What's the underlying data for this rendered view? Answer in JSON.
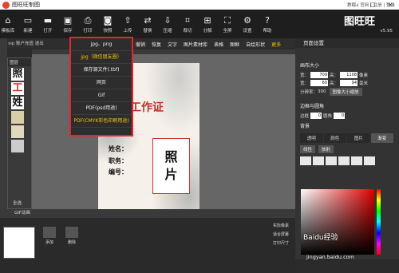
{
  "window": {
    "title": "图旺旺制图",
    "controls": [
      "—",
      "☐",
      "✕"
    ]
  },
  "toolbar": {
    "items": [
      {
        "label": "模板库",
        "icon": "home-icon"
      },
      {
        "label": "新建",
        "icon": "new-file-icon"
      },
      {
        "label": "打开",
        "icon": "folder-icon"
      },
      {
        "label": "保存",
        "icon": "save-icon"
      },
      {
        "label": "打印",
        "icon": "print-icon"
      },
      {
        "label": "快照",
        "icon": "camera-icon"
      },
      {
        "label": "上传",
        "icon": "upload-icon"
      },
      {
        "label": "替换",
        "icon": "replace-icon"
      },
      {
        "label": "压缩",
        "icon": "compress-icon"
      },
      {
        "label": "裁切",
        "icon": "crop-icon"
      },
      {
        "label": "分解",
        "icon": "split-icon"
      },
      {
        "label": "全屏",
        "icon": "fullscreen-icon"
      },
      {
        "label": "设置",
        "icon": "gear-icon"
      },
      {
        "label": "帮助",
        "icon": "help-icon"
      }
    ],
    "top_links": "教程 | 官网 | 注册 | 登录",
    "brand": "图旺旺",
    "brand_sub": "TUWANGWANG",
    "version": "v5.95"
  },
  "subbar": {
    "left_text": "vip 账户充值 退出",
    "actions": [
      "撤销",
      "恢复",
      "文字",
      "图片素材库",
      "表格",
      "图框",
      "自绘形状",
      "更多"
    ]
  },
  "save_menu": {
    "items": [
      "jpg、png",
      "jpg（微信朋友圈）",
      "保存源文件(.tbf)",
      "网页",
      "Gif",
      "PDF(psd用途)",
      "PDF(CMYK彩色印刷用途)"
    ]
  },
  "left_panel": {
    "title": "图层",
    "thumbs": [
      "照",
      "工",
      "姓"
    ],
    "footer": "全选"
  },
  "canvas": {
    "badge_title": "工作证",
    "fields": [
      "姓名：",
      "职务：",
      "编号："
    ],
    "photo_lines": [
      "照",
      "片"
    ]
  },
  "right_panel": {
    "title": "页面设置",
    "size_section": "画布大小",
    "width_label": "宽：",
    "width_px": "709",
    "height_label": "高：",
    "height_px": "1108",
    "px_unit": "像素",
    "width_mm": "60",
    "height_mm": "94",
    "mm_unit": "毫米",
    "dpi_label": "分辨率：",
    "dpi_value": "300",
    "zoom_button": "图像大小缩放",
    "border_section": "边框与圆角",
    "border_label": "边框",
    "radius_label": "圆角",
    "border_value": "0",
    "radius_value": "0",
    "bg_section": "背景",
    "bg_tabs": [
      "透明",
      "颜色",
      "图片",
      "渐变"
    ],
    "bg_active": "渐变",
    "gradient_types": [
      "线性",
      "放射"
    ]
  },
  "bottom": {
    "bar_label": "GIF动画",
    "buttons": [
      {
        "label": "添加",
        "icon": "add-icon"
      },
      {
        "label": "删除",
        "icon": "delete-icon"
      }
    ],
    "side_items": [
      "实际像素",
      "适合屏幕",
      "打印尺寸"
    ]
  },
  "watermark": {
    "text": "Baidu经验",
    "url": "jingyan.baidu.com"
  }
}
